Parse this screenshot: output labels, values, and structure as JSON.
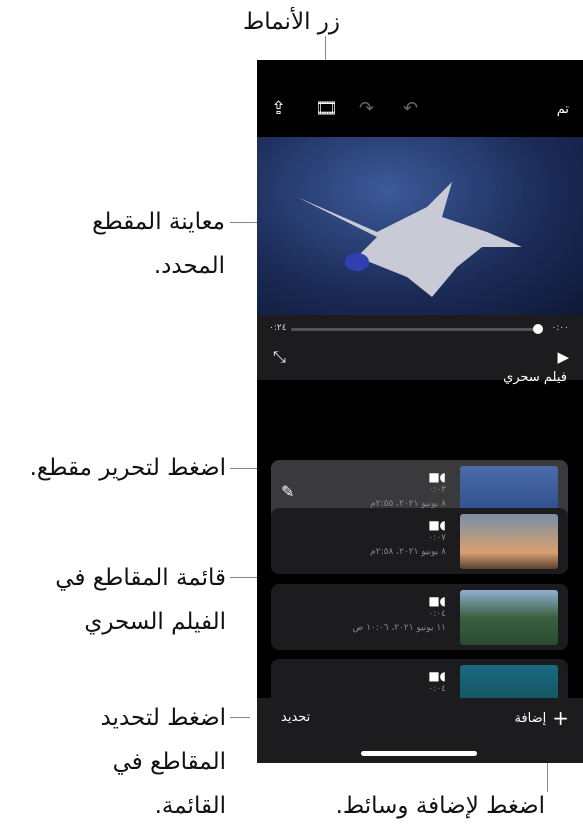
{
  "callouts": {
    "styles_button": "زر الأنماط",
    "preview": "معاينة المقطع المحدد.",
    "edit_clip": "اضغط لتحرير مقطع.",
    "clip_list": "قائمة المقاطع في الفيلم السحري",
    "select": "اضغط لتحديد المقاطع في القائمة.",
    "add_media": "اضغط لإضافة وسائط."
  },
  "toolbar": {
    "done": "تم",
    "icons": [
      "share-icon",
      "styles-icon",
      "redo-icon",
      "undo-icon"
    ]
  },
  "player": {
    "elapsed": "٠:٠٠",
    "remaining": "٠:٢٤",
    "progress": 0
  },
  "movie_title": "فيلم سحري",
  "clips": [
    {
      "duration": "٠:٠٣",
      "date": "٨ يونيو ٢٠٢١، ٢:٥٥م",
      "selected": true
    },
    {
      "duration": "٠:٠٧",
      "date": "٨ يونيو ٢٠٢١، ٢:٥٨م"
    },
    {
      "duration": "٠:٠٤",
      "date": "١١ يونيو ٢٠٢١، ١٠:٠٦ ص"
    },
    {
      "duration": "٠:٠٤"
    }
  ],
  "bottom": {
    "select": "تحديد",
    "add": "إضافة"
  }
}
